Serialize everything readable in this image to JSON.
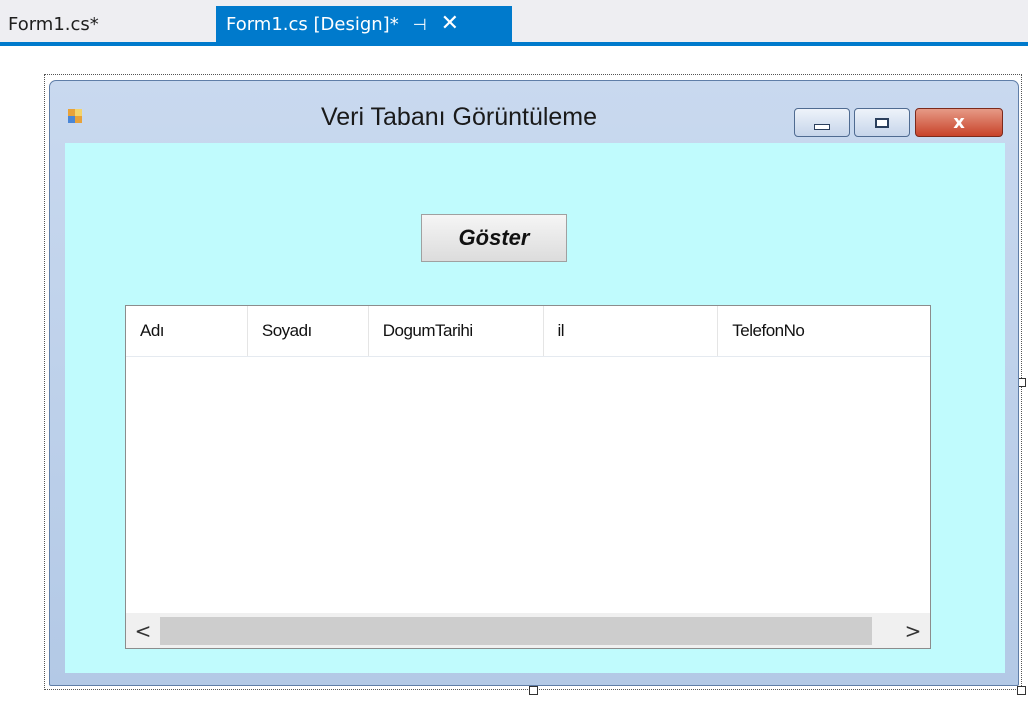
{
  "tabs": [
    {
      "label": "Form1.cs*",
      "active": false
    },
    {
      "label": "Form1.cs [Design]*",
      "active": true
    }
  ],
  "tab_icons": {
    "pin": "pin-icon",
    "close": "close-icon"
  },
  "form": {
    "title": "Veri Tabanı Görüntüleme",
    "close_glyph": "x",
    "client_color": "#c0fbfd",
    "show_button_label": "Göster",
    "listview": {
      "columns": [
        "Adı",
        "Soyadı",
        "DogumTarihi",
        "il",
        "TelefonNo"
      ],
      "rows": [],
      "scroll_left": "<",
      "scroll_right": ">"
    }
  },
  "colors": {
    "accent": "#007acc",
    "close_button": "#c8432a"
  }
}
